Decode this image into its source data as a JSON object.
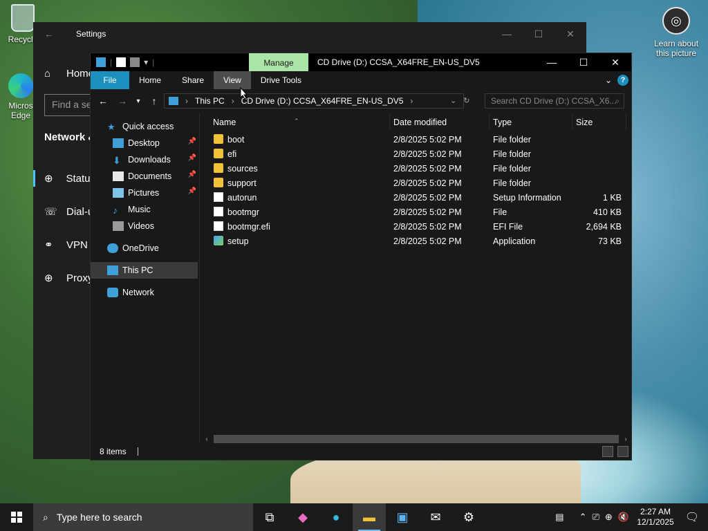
{
  "desktop": {
    "recycle_label": "Recycle",
    "edge_label": "Micros Edge",
    "learn_label": "Learn about this picture"
  },
  "settings": {
    "title": "Settings",
    "find_placeholder": "Find a se",
    "home": "Home",
    "section": "Network &",
    "nav": [
      {
        "label": "Status",
        "icon": "globe-icon"
      },
      {
        "label": "Dial-u",
        "icon": "dialup-icon"
      },
      {
        "label": "VPN",
        "icon": "vpn-icon"
      },
      {
        "label": "Proxy",
        "icon": "globe-icon"
      }
    ]
  },
  "explorer": {
    "title": "CD Drive (D:) CCSA_X64FRE_EN-US_DV5",
    "manage": "Manage",
    "tabs": [
      "File",
      "Home",
      "Share",
      "View",
      "Drive Tools"
    ],
    "breadcrumb": [
      "This PC",
      "CD Drive (D:) CCSA_X64FRE_EN-US_DV5"
    ],
    "search_placeholder": "Search CD Drive (D:) CCSA_X6...",
    "nav": {
      "quick_access": "Quick access",
      "items": [
        {
          "label": "Desktop",
          "pinned": true
        },
        {
          "label": "Downloads",
          "pinned": true
        },
        {
          "label": "Documents",
          "pinned": true
        },
        {
          "label": "Pictures",
          "pinned": true
        },
        {
          "label": "Music",
          "pinned": false
        },
        {
          "label": "Videos",
          "pinned": false
        }
      ],
      "onedrive": "OneDrive",
      "this_pc": "This PC",
      "network": "Network"
    },
    "columns": [
      "Name",
      "Date modified",
      "Type",
      "Size"
    ],
    "files": [
      {
        "name": "boot",
        "date": "2/8/2025 5:02 PM",
        "type": "File folder",
        "size": "",
        "icon": "folder"
      },
      {
        "name": "efi",
        "date": "2/8/2025 5:02 PM",
        "type": "File folder",
        "size": "",
        "icon": "folder"
      },
      {
        "name": "sources",
        "date": "2/8/2025 5:02 PM",
        "type": "File folder",
        "size": "",
        "icon": "folder"
      },
      {
        "name": "support",
        "date": "2/8/2025 5:02 PM",
        "type": "File folder",
        "size": "",
        "icon": "folder"
      },
      {
        "name": "autorun",
        "date": "2/8/2025 5:02 PM",
        "type": "Setup Information",
        "size": "1 KB",
        "icon": "doc"
      },
      {
        "name": "bootmgr",
        "date": "2/8/2025 5:02 PM",
        "type": "File",
        "size": "410 KB",
        "icon": "doc"
      },
      {
        "name": "bootmgr.efi",
        "date": "2/8/2025 5:02 PM",
        "type": "EFI File",
        "size": "2,694 KB",
        "icon": "doc"
      },
      {
        "name": "setup",
        "date": "2/8/2025 5:02 PM",
        "type": "Application",
        "size": "73 KB",
        "icon": "setup"
      }
    ],
    "status": "8 items"
  },
  "taskbar": {
    "search_placeholder": "Type here to search",
    "time": "2:27 AM",
    "date": "12/1/2025"
  },
  "colors": {
    "file_tab": "#1b8fbe",
    "manage_tab": "#ace5a8",
    "folder": "#f0c23a"
  }
}
